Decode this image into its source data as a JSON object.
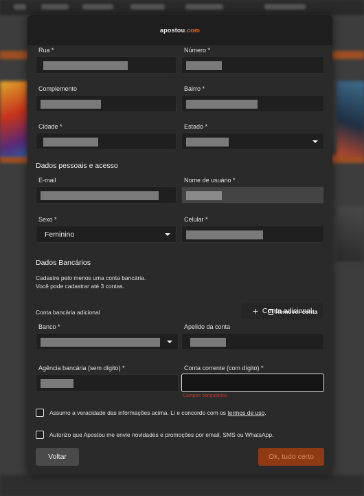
{
  "brand": {
    "name_part1": "apostou",
    "name_part2": ".com",
    "accent": "#f26a1b"
  },
  "address": {
    "street_label": "Rua *",
    "number_label": "Número *",
    "complement_label": "Complemento",
    "district_label": "Bairro *",
    "city_label": "Cidade *",
    "state_label": "Estado *"
  },
  "personal": {
    "section_title": "Dados pessoais e acesso",
    "email_label": "E-mail",
    "username_label": "Nome de usuário *",
    "sex_label": "Sexo *",
    "sex_value": "Feminino",
    "phone_label": "Celular *"
  },
  "bank": {
    "section_title": "Dados Bancários",
    "hint_line1": "Cadastre pelo menos uma conta bancária.",
    "hint_line2": "Você pode cadastrar até 3 contas.",
    "add_account_label": "Conta adicional",
    "additional_account_title": "Conta bancária adicional",
    "remove_account_label": "Remover conta",
    "bank_label": "Banco *",
    "nickname_label": "Apelido da conta",
    "agency_label": "Agência bancária (sem dígito) *",
    "account_label": "Conta corrente (com dígito) *",
    "required_error": "Campos obrigatórios"
  },
  "consents": {
    "terms_text": "Assumo a veracidade das informações acima. Li e concordo com os ",
    "terms_link": "termos de uso",
    "terms_end": ".",
    "marketing_text": "Autorizo que Apostou me envie novidades e promoções por email, SMS ou WhatsApp."
  },
  "footer": {
    "back_label": "Voltar",
    "submit_label": "Ok, tudo certo"
  }
}
